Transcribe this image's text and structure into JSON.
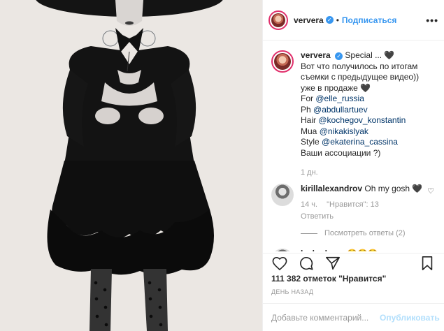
{
  "post": {
    "username": "ververa",
    "follow_label": "Подписаться",
    "more_label": "•••"
  },
  "caption": {
    "username": "ververa",
    "lines": [
      "Special ... 🖤",
      "Вот что получилось по итогам съемки с предыдущее видео)) уже в продаже 🖤"
    ],
    "credits": [
      {
        "prefix": "For ",
        "mention": "@elle_russia"
      },
      {
        "prefix": "Ph ",
        "mention": "@abdullartuev"
      },
      {
        "prefix": "Hair ",
        "mention": "@kochegov_konstantin"
      },
      {
        "prefix": "Mua ",
        "mention": "@nikakislyak"
      },
      {
        "prefix": "Style ",
        "mention": "@ekaterina_cassina"
      }
    ],
    "question": "Ваши ассоциации ?)",
    "time": "1 дн."
  },
  "comments": [
    {
      "username": "kirillalexandrov",
      "text": "Oh my gosh 🖤",
      "time": "14 ч.",
      "likes": "\"Нравится\": 13",
      "reply": "Ответить",
      "view_replies": "Посмотреть ответы (2)"
    },
    {
      "username": "leshadoma",
      "text": "😳😳😳"
    }
  ],
  "stats": {
    "likes": "111 382 отметок \"Нравится\"",
    "date": "ДЕНЬ НАЗАД"
  },
  "add_comment": {
    "placeholder": "Добавьте комментарий...",
    "publish": "Опубликовать"
  },
  "icons": {
    "like": "heart-icon",
    "comment": "comment-icon",
    "share": "share-icon",
    "save": "bookmark-icon"
  }
}
